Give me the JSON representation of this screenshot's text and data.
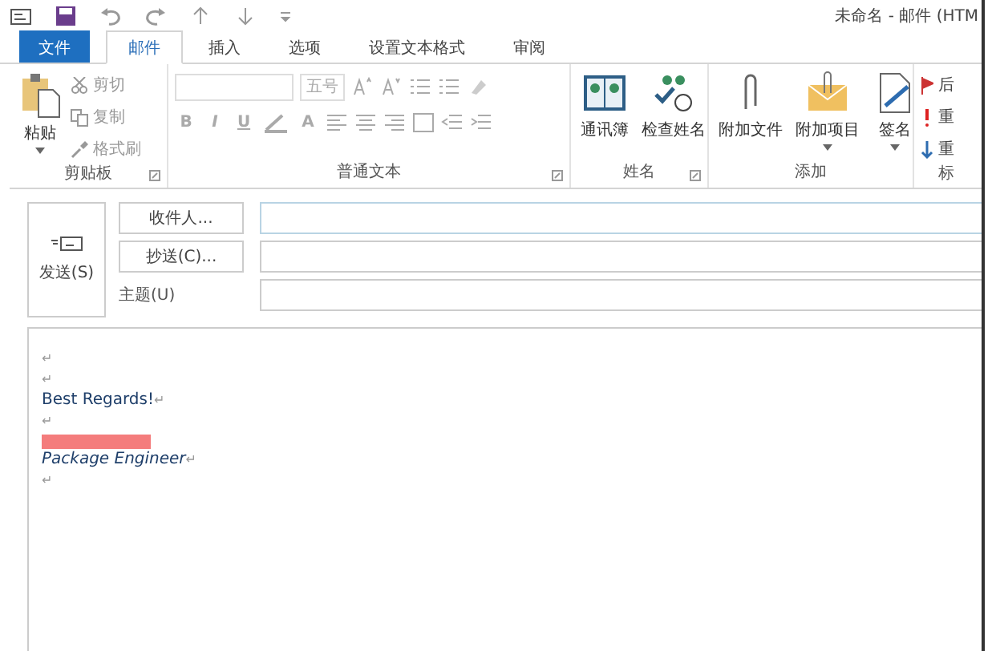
{
  "window": {
    "title": "未命名 - 邮件 (HTM"
  },
  "tabs": [
    {
      "label": "文件",
      "kind": "file",
      "selected": false
    },
    {
      "label": "邮件",
      "kind": "tab",
      "selected": true
    },
    {
      "label": "插入",
      "kind": "tab",
      "selected": false
    },
    {
      "label": "选项",
      "kind": "tab",
      "selected": false
    },
    {
      "label": "设置文本格式",
      "kind": "tab",
      "selected": false
    },
    {
      "label": "审阅",
      "kind": "tab",
      "selected": false
    }
  ],
  "clipboard": {
    "label": "剪贴板",
    "paste": "粘贴",
    "cut": "剪切",
    "copy": "复制",
    "painter": "格式刷",
    "disabled": true
  },
  "basic_text": {
    "label": "普通文本",
    "font_size": "五号",
    "bold": "B",
    "italic": "I",
    "underline": "U",
    "font_color": "A",
    "disabled": true
  },
  "names": {
    "label": "姓名",
    "buttons": [
      "通讯簿",
      "检查姓名"
    ]
  },
  "include": {
    "label": "添加",
    "buttons": [
      "附加文件",
      "附加项目",
      "签名"
    ]
  },
  "tags": {
    "label": "标",
    "items": [
      "后",
      "重",
      "重"
    ]
  },
  "compose": {
    "send": "发送(S)",
    "to": "收件人...",
    "cc": "抄送(C)...",
    "subject": "主题(U)"
  },
  "body": [
    {
      "kind": "mark",
      "mark": "↵"
    },
    {
      "kind": "mark",
      "mark": "↵"
    },
    {
      "kind": "text",
      "text": "Best Regards!",
      "mark": "↵"
    },
    {
      "kind": "mark",
      "mark": "↵"
    },
    {
      "kind": "redacted"
    },
    {
      "kind": "italic",
      "text": "Package Engineer",
      "mark": "↵"
    },
    {
      "kind": "mark",
      "mark": "↵"
    }
  ]
}
